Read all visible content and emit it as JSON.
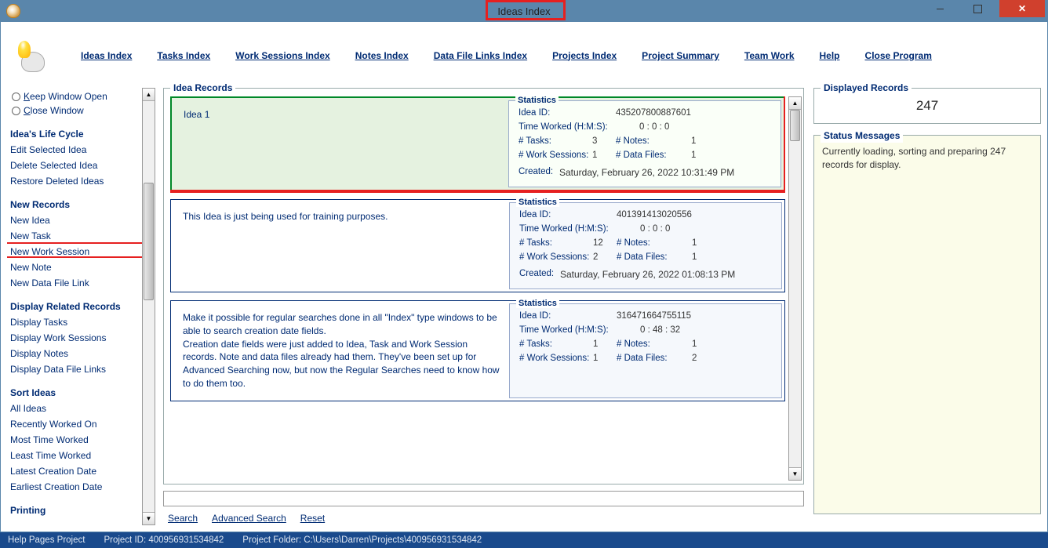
{
  "title": "Ideas Index",
  "menu": {
    "ideas": "Ideas Index",
    "tasks": "Tasks Index",
    "work": "Work Sessions Index",
    "notes": "Notes Index",
    "datalinks": "Data File Links Index",
    "projects": "Projects Index",
    "summary": "Project Summary",
    "team": "Team Work",
    "help": "Help",
    "close": "Close Program"
  },
  "sidebar": {
    "keep_open": "Keep Window Open",
    "close_window": "Close Window",
    "life_cycle": "Idea's Life Cycle",
    "edit_selected": "Edit Selected Idea",
    "delete_selected": "Delete Selected Idea",
    "restore": "Restore Deleted Ideas",
    "new_records": "New Records",
    "new_idea": "New Idea",
    "new_task": "New Task",
    "new_work": "New Work Session",
    "new_note": "New Note",
    "new_data": "New Data File Link",
    "display_related": "Display Related Records",
    "display_tasks": "Display Tasks",
    "display_work": "Display Work Sessions",
    "display_notes": "Display Notes",
    "display_data": "Display Data File Links",
    "sort_ideas": "Sort Ideas",
    "all_ideas": "All Ideas",
    "recently": "Recently Worked On",
    "most_time": "Most Time Worked",
    "least_time": "Least Time Worked",
    "latest_date": "Latest Creation Date",
    "earliest_date": "Earliest Creation Date",
    "printing": "Printing"
  },
  "records_legend": "Idea Records",
  "statistics_legend": "Statistics",
  "stats_labels": {
    "idea_id": "Idea ID:",
    "time_worked": "Time Worked (H:M:S):",
    "tasks": "# Tasks:",
    "notes": "# Notes:",
    "work_sessions": "# Work Sessions:",
    "data_files": "# Data Files:",
    "created": "Created:"
  },
  "records": [
    {
      "title": "Idea 1",
      "idea_id": "435207800887601",
      "time": "0  :  0   :  0",
      "tasks": "3",
      "notes": "1",
      "work": "1",
      "data": "1",
      "created": "Saturday, February 26, 2022   10:31:49 PM"
    },
    {
      "title": "This Idea is just being used for training purposes.",
      "idea_id": "401391413020556",
      "time": "0  :  0   :  0",
      "tasks": "12",
      "notes": "1",
      "work": "2",
      "data": "1",
      "created": "Saturday, February 26, 2022   01:08:13 PM"
    },
    {
      "title": "Make it possible for regular searches done in all \"Index\" type windows to be able to search creation date fields.\nCreation date fields were just added to Idea, Task and Work Session records. Note and data files already had them. They've been set up for Advanced Searching now, but now the Regular Searches need to know how to do them too.",
      "idea_id": "316471664755115",
      "time": "0  :  48   :  32",
      "tasks": "1",
      "notes": "1",
      "work": "1",
      "data": "2",
      "created": ""
    }
  ],
  "search": {
    "search": "Search",
    "advanced": "Advanced Search",
    "reset": "Reset"
  },
  "displayed": {
    "legend": "Displayed Records",
    "value": "247"
  },
  "status": {
    "legend": "Status Messages",
    "text": "Currently loading, sorting and preparing 247 records for display."
  },
  "statusbar": {
    "help_pages": "Help Pages Project",
    "project_id": "Project ID:  400956931534842",
    "project_folder": "Project Folder:  C:\\Users\\Darren\\Projects\\400956931534842"
  }
}
